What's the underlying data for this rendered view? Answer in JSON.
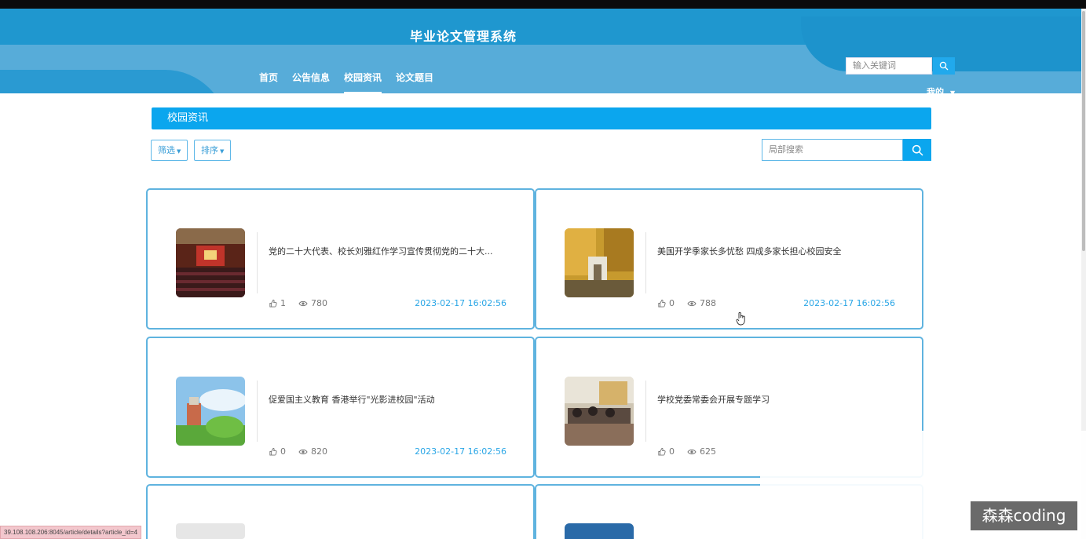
{
  "app": {
    "title": "毕业论文管理系统",
    "nav": [
      "首页",
      "公告信息",
      "校园资讯",
      "论文题目"
    ],
    "active_nav": "校园资讯",
    "search_placeholder": "输入关键词",
    "user_menu": "我的"
  },
  "section": {
    "title": "校园资讯",
    "filter_label": "筛选",
    "sort_label": "排序",
    "local_search_placeholder": "局部搜索"
  },
  "articles": [
    {
      "title": "党的二十大代表、校长刘雅红作学习宣传贯彻党的二十大...",
      "likes": "1",
      "views": "780",
      "date": "2023-02-17 16:02:56"
    },
    {
      "title": "美国开学季家长多忧愁 四成多家长担心校园安全",
      "likes": "0",
      "views": "788",
      "date": "2023-02-17 16:02:56"
    },
    {
      "title": "促爱国主义教育 香港举行\"光影进校园\"活动",
      "likes": "0",
      "views": "820",
      "date": "2023-02-17 16:02:56"
    },
    {
      "title": "学校党委常委会开展专题学习",
      "likes": "0",
      "views": "625",
      "date": ""
    }
  ],
  "status_url": "39.108.108.206:8045/article/details?article_id=4",
  "watermark": "森森coding",
  "colors": {
    "header": "#1f97cf",
    "accent": "#0ba6ee",
    "date": "#2aa6e6",
    "card_border": "#5fb3df"
  },
  "icons": [
    "search-icon",
    "like-icon",
    "eye-icon",
    "hand-cursor-icon"
  ]
}
